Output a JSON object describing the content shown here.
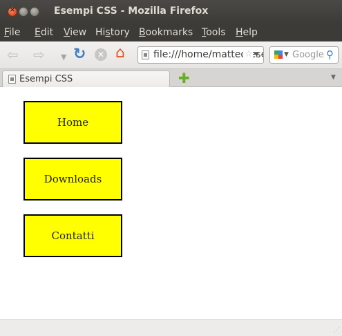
{
  "window": {
    "title": "Esempi CSS - Mozilla Firefox"
  },
  "menubar": {
    "items": [
      {
        "pre": "",
        "u": "F",
        "post": "ile"
      },
      {
        "pre": "",
        "u": "E",
        "post": "dit"
      },
      {
        "pre": "",
        "u": "V",
        "post": "iew"
      },
      {
        "pre": "Hi",
        "u": "s",
        "post": "tory"
      },
      {
        "pre": "",
        "u": "B",
        "post": "ookmarks"
      },
      {
        "pre": "",
        "u": "T",
        "post": "ools"
      },
      {
        "pre": "",
        "u": "H",
        "post": "elp"
      }
    ]
  },
  "navbar": {
    "url": "file:///home/matteo/esempi/index.html",
    "search_placeholder": "Google"
  },
  "tabs": [
    {
      "label": "Esempi CSS"
    }
  ],
  "content": {
    "links": [
      {
        "label": "Home"
      },
      {
        "label": "Downloads"
      },
      {
        "label": "Contatti"
      }
    ],
    "box_color": "#ffff00",
    "border_color": "#000000"
  },
  "icons": {
    "back": "back-arrow-icon",
    "forward": "forward-arrow-icon",
    "reload": "reload-icon",
    "stop": "stop-icon",
    "home": "home-icon",
    "bookmark": "star-icon",
    "search": "magnifier-icon",
    "new_tab": "plus-icon"
  }
}
